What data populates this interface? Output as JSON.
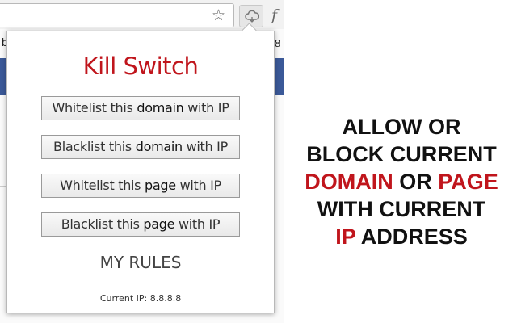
{
  "browser": {
    "star_icon": "star-icon",
    "extension_icon": "cloud-icon",
    "fragment_b": "b",
    "fragment_8": "8",
    "fragment_f": "f"
  },
  "popup": {
    "title": "Kill Switch",
    "buttons": [
      {
        "pre": "Whitelist this ",
        "bold": "domain",
        "post": " with IP"
      },
      {
        "pre": "Blacklist this ",
        "bold": "domain",
        "post": " with IP"
      },
      {
        "pre": "Whitelist this ",
        "bold": "page",
        "post": " with IP"
      },
      {
        "pre": "Blacklist this ",
        "bold": "page",
        "post": " with IP"
      }
    ],
    "my_rules": "MY RULES",
    "current_ip": "Current IP: 8.8.8.8"
  },
  "tagline": {
    "line1": "ALLOW OR",
    "line2": "BLOCK CURRENT",
    "line3_a": "DOMAIN",
    "line3_b": " OR ",
    "line3_c": "PAGE",
    "line4": "WITH CURRENT",
    "line5_a": "IP",
    "line5_b": " ADDRESS"
  },
  "colors": {
    "accent_red": "#c0151c",
    "facebook_blue": "#3b5998"
  }
}
